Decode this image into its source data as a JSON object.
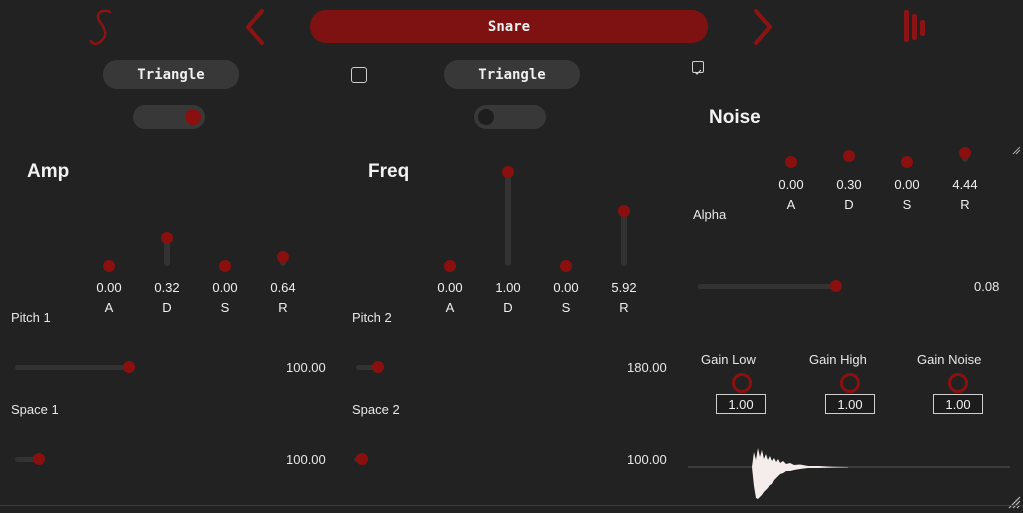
{
  "header": {
    "logo_icon": "s-logo-icon",
    "prev_icon": "chevron-left-icon",
    "next_icon": "chevron-right-icon",
    "menu_icon": "bars-icon",
    "preset_name": "Snare",
    "accent": "#7e1212"
  },
  "osc1": {
    "waveform": "Triangle",
    "toggle_on": true
  },
  "osc2": {
    "waveform": "Triangle",
    "toggle_on": false
  },
  "link_checked": false,
  "noise_checked": true,
  "amp": {
    "title": "Amp",
    "env": [
      {
        "value": "0.00",
        "label": "A",
        "level": 0.0
      },
      {
        "value": "0.32",
        "label": "D",
        "level": 0.3
      },
      {
        "value": "0.00",
        "label": "S",
        "level": 0.0
      },
      {
        "value": "0.64",
        "label": "R",
        "level": 0.1
      }
    ],
    "pitch": {
      "label": "Pitch 1",
      "value": "100.00",
      "level": 0.49
    },
    "space": {
      "label": "Space 1",
      "value": "100.00",
      "level": 0.11
    }
  },
  "freq": {
    "title": "Freq",
    "env": [
      {
        "value": "0.00",
        "label": "A",
        "level": 0.0
      },
      {
        "value": "1.00",
        "label": "D",
        "level": 1.0
      },
      {
        "value": "0.00",
        "label": "S",
        "level": 0.0
      },
      {
        "value": "5.92",
        "label": "R",
        "level": 0.59
      }
    ],
    "pitch": {
      "label": "Pitch 2",
      "value": "180.00",
      "level": 0.09
    },
    "space": {
      "label": "Space 2",
      "value": "100.00",
      "level": 0.0
    }
  },
  "noise": {
    "title": "Noise",
    "env": [
      {
        "value": "0.00",
        "label": "A",
        "level": 0.0
      },
      {
        "value": "0.30",
        "label": "D",
        "level": 0.3
      },
      {
        "value": "0.00",
        "label": "S",
        "level": 0.0
      },
      {
        "value": "4.44",
        "label": "R",
        "level": 0.44
      }
    ],
    "alpha": {
      "label": "Alpha",
      "value": "0.08",
      "level": 0.98
    }
  },
  "gains": [
    {
      "label": "Gain Low",
      "value": "1.00"
    },
    {
      "label": "Gain High",
      "value": "1.00"
    },
    {
      "label": "Gain Noise",
      "value": "1.00"
    }
  ]
}
